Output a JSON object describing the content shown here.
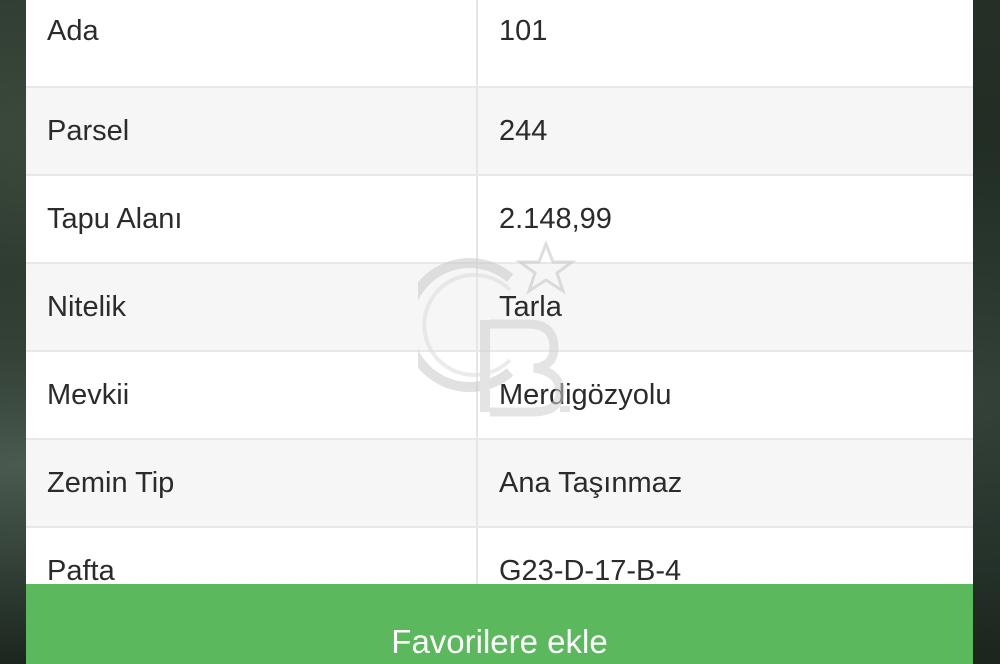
{
  "details": {
    "rows": [
      {
        "label": "Ada",
        "value": "101"
      },
      {
        "label": "Parsel",
        "value": "244"
      },
      {
        "label": "Tapu Alanı",
        "value": "2.148,99"
      },
      {
        "label": "Nitelik",
        "value": "Tarla"
      },
      {
        "label": "Mevkii",
        "value": "Merdigözyolu"
      },
      {
        "label": "Zemin Tip",
        "value": "Ana Taşınmaz"
      },
      {
        "label": "Pafta",
        "value": "G23-D-17-B-4"
      }
    ]
  },
  "actions": {
    "favorite_label": "Favorilere ekle"
  },
  "watermark": {
    "icon": "cb-logo-star"
  },
  "colors": {
    "button_green": "#5cb85c",
    "row_alt": "#f6f6f6",
    "text": "#2b2b2b"
  }
}
